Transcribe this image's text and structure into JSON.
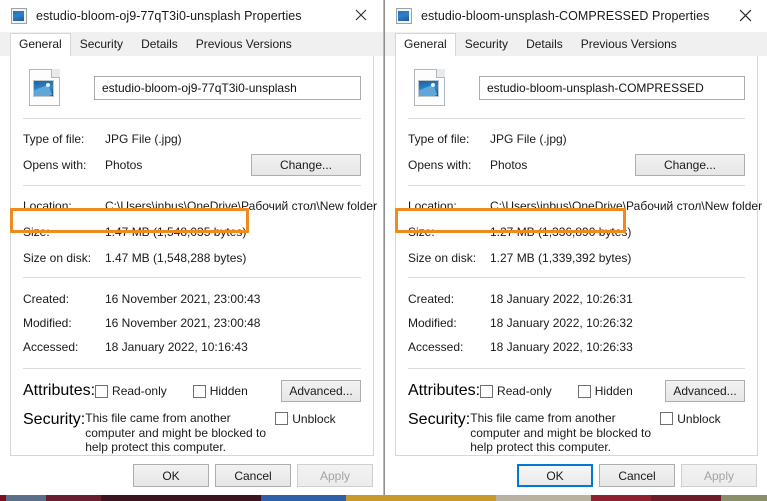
{
  "theme": {
    "highlight_color": "#f08a1e",
    "focus_color": "#0078d7",
    "window_bg": "#ffffff",
    "tabstrip_bg": "#f0f0f0"
  },
  "windows": [
    {
      "title": "estudio-bloom-oj9-77qT3i0-unsplash Properties",
      "titlebar_icon": "image-file-icon",
      "close_label": "✕",
      "tabs": [
        {
          "label": "General",
          "active": true
        },
        {
          "label": "Security",
          "active": false
        },
        {
          "label": "Details",
          "active": false
        },
        {
          "label": "Previous Versions",
          "active": false
        }
      ],
      "file_icon": "jpg-image-file-icon",
      "filename": "estudio-bloom-oj9-77qT3i0-unsplash",
      "type_of_file_label": "Type of file:",
      "type_of_file_value": "JPG File (.jpg)",
      "opens_with_label": "Opens with:",
      "opens_with_value": "Photos",
      "change_button": "Change...",
      "location_label": "Location:",
      "location_value": "C:\\Users\\inbus\\OneDrive\\Рабочий стол\\New folder",
      "size_label": "Size:",
      "size_value": "1.47 MB (1,548,035 bytes)",
      "size_on_disk_label": "Size on disk:",
      "size_on_disk_value": "1.47 MB (1,548,288 bytes)",
      "created_label": "Created:",
      "created_value": "16 November 2021, 23:00:43",
      "modified_label": "Modified:",
      "modified_value": "16 November 2021, 23:00:48",
      "accessed_label": "Accessed:",
      "accessed_value": "18 January 2022, 10:16:43",
      "attributes_label": "Attributes:",
      "readonly_label": "Read-only",
      "hidden_label": "Hidden",
      "advanced_button": "Advanced...",
      "security_label": "Security:",
      "security_text": "This file came from another computer and might be blocked to help protect this computer.",
      "unblock_label": "Unblock",
      "ok_button": "OK",
      "cancel_button": "Cancel",
      "apply_button": "Apply",
      "ok_focused": false,
      "apply_disabled": true,
      "size_highlighted": true
    },
    {
      "title": "estudio-bloom-unsplash-COMPRESSED Properties",
      "titlebar_icon": "image-file-icon",
      "close_label": "✕",
      "tabs": [
        {
          "label": "General",
          "active": true
        },
        {
          "label": "Security",
          "active": false
        },
        {
          "label": "Details",
          "active": false
        },
        {
          "label": "Previous Versions",
          "active": false
        }
      ],
      "file_icon": "jpg-image-file-icon",
      "filename": "estudio-bloom-unsplash-COMPRESSED",
      "type_of_file_label": "Type of file:",
      "type_of_file_value": "JPG File (.jpg)",
      "opens_with_label": "Opens with:",
      "opens_with_value": "Photos",
      "change_button": "Change...",
      "location_label": "Location:",
      "location_value": "C:\\Users\\inbus\\OneDrive\\Рабочий стол\\New folder",
      "size_label": "Size:",
      "size_value": "1.27 MB (1,336,890 bytes)",
      "size_on_disk_label": "Size on disk:",
      "size_on_disk_value": "1.27 MB (1,339,392 bytes)",
      "created_label": "Created:",
      "created_value": "18 January 2022, 10:26:31",
      "modified_label": "Modified:",
      "modified_value": "18 January 2022, 10:26:32",
      "accessed_label": "Accessed:",
      "accessed_value": "18 January 2022, 10:26:33",
      "attributes_label": "Attributes:",
      "readonly_label": "Read-only",
      "hidden_label": "Hidden",
      "advanced_button": "Advanced...",
      "security_label": "Security:",
      "security_text": "This file came from another computer and might be blocked to help protect this computer.",
      "unblock_label": "Unblock",
      "ok_button": "OK",
      "cancel_button": "Cancel",
      "apply_button": "Apply",
      "ok_focused": true,
      "apply_disabled": true,
      "size_highlighted": true
    }
  ]
}
